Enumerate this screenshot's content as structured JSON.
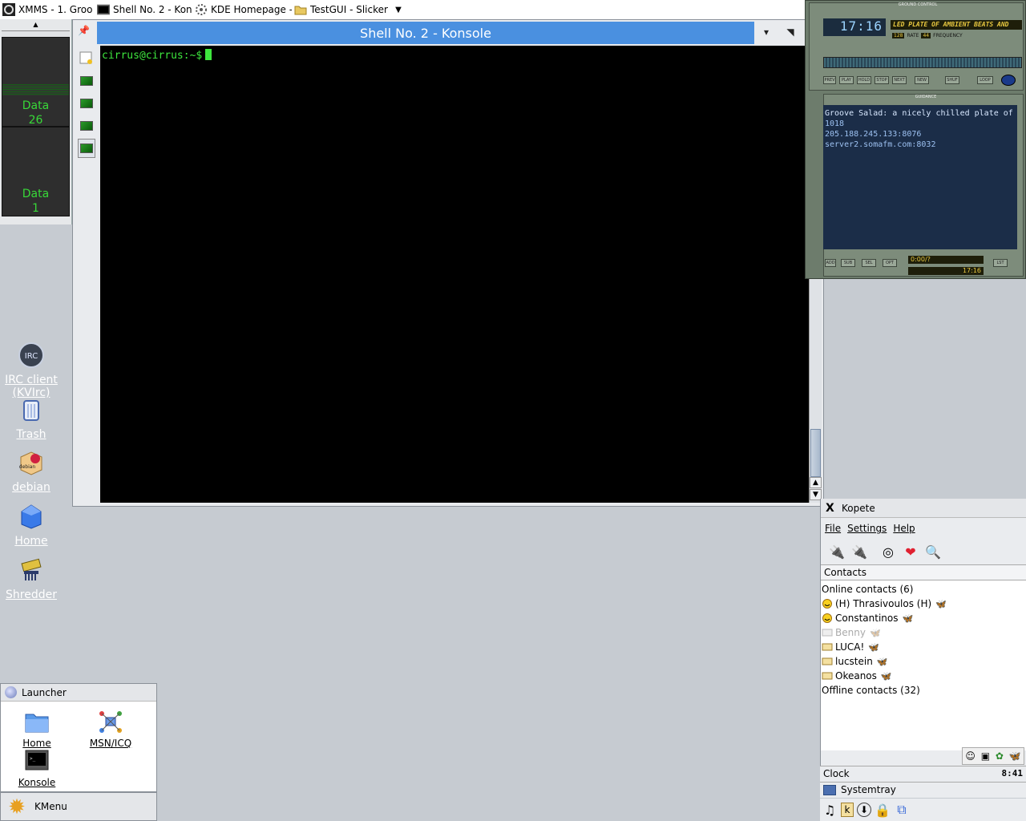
{
  "taskbar": {
    "tasks": [
      {
        "label": "XMMS - 1.  Groo",
        "icon": "xmms-icon"
      },
      {
        "label": "Shell No. 2 - Kon",
        "icon": "konsole-icon"
      },
      {
        "label": "KDE Homepage -",
        "icon": "kde-icon"
      },
      {
        "label": "TestGUI - Slicker",
        "icon": "folder-icon"
      }
    ],
    "dropdown": "▼"
  },
  "pager": {
    "desktops": [
      {
        "label": "Data",
        "value": "26"
      },
      {
        "label": "Data",
        "value": "1"
      }
    ]
  },
  "desktop_icons": [
    {
      "label_line1": "IRC client",
      "label_line2": "(KVIrc)",
      "icon": "irc-icon"
    },
    {
      "label_line1": "Trash",
      "icon": "trash-icon"
    },
    {
      "label_line1": "debian",
      "icon": "debian-icon"
    },
    {
      "label_line1": "Home",
      "icon": "home-icon"
    },
    {
      "label_line1": "Shredder",
      "icon": "shredder-icon"
    }
  ],
  "konsole": {
    "title": "Shell No. 2 - Konsole",
    "prompt": "cirrus@cirrus:~$"
  },
  "xmms": {
    "panel_title": "GROUND CONTROL",
    "time": "17:16",
    "marquee": "LED PLATE OF AMBIENT BEATS AND",
    "rate": "128",
    "rate_label": "RATE",
    "freq": "44",
    "freq_label": "FREQUENCY",
    "buttons": [
      "PREV",
      "PLAY",
      "HOLD",
      "STOP",
      "NEXT",
      "NEW",
      "SHUF",
      "LOOP"
    ],
    "guidance_title": "GUIDANCE",
    "info": [
      "Groove Salad: a nicely chilled plate of ambie...",
      "1018",
      "205.188.245.133:8076",
      "server2.somafm.com:8032"
    ],
    "bottom_buttons": [
      "ADD",
      "SUB",
      "SEL",
      "OPT",
      "LST"
    ],
    "time_display1": "0:00/?",
    "time_display2": "17:16"
  },
  "kopete": {
    "title": "Kopete",
    "menu": [
      "File",
      "Settings",
      "Help"
    ],
    "contacts_header": "Contacts",
    "online_group": "Online contacts (6)",
    "contacts": [
      {
        "name": "(H) Thrasivoulos (H)",
        "status": "online"
      },
      {
        "name": "Constantinos",
        "status": "online"
      },
      {
        "name": "Benny",
        "status": "offline"
      },
      {
        "name": "LUCA!",
        "status": "away"
      },
      {
        "name": "lucstein",
        "status": "away"
      },
      {
        "name": "Okeanos",
        "status": "away"
      }
    ],
    "offline_group": "Offline contacts (32)"
  },
  "clock": {
    "label": "Clock",
    "time": "8:41"
  },
  "systray": {
    "label": "Systemtray"
  },
  "launcher": {
    "title": "Launcher",
    "items": [
      {
        "label": "Home",
        "icon": "home-folder-icon"
      },
      {
        "label": "MSN/ICQ",
        "icon": "network-icon"
      },
      {
        "label": "Konsole",
        "icon": "konsole-icon"
      }
    ]
  },
  "kmenu": {
    "label": "KMenu"
  },
  "colors": {
    "desktop": "#c6cbd1",
    "konsole_title": "#4a90e0",
    "terminal_text": "#3ee63e",
    "xmms_body": "#6d7c6c"
  }
}
